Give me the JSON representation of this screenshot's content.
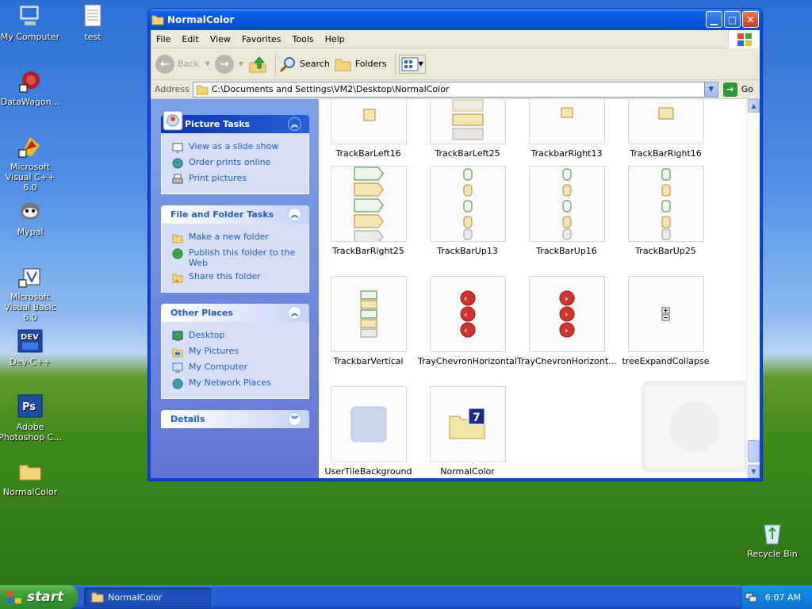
{
  "desktop": {
    "icons": [
      {
        "label": "My Computer"
      },
      {
        "label": "test"
      },
      {
        "label": "DataWagon..."
      },
      {
        "label": "Microsoft Visual C++ 6.0"
      },
      {
        "label": "Mypal"
      },
      {
        "label": "Microsoft Visual Basic 6.0"
      },
      {
        "label": "Dev-C++"
      },
      {
        "label": "Adobe Photoshop C..."
      },
      {
        "label": "NormalColor"
      },
      {
        "label": "Recycle Bin"
      }
    ]
  },
  "window": {
    "title": "NormalColor",
    "menu": [
      "File",
      "Edit",
      "View",
      "Favorites",
      "Tools",
      "Help"
    ],
    "toolbar": {
      "back": "Back",
      "search": "Search",
      "folders": "Folders"
    },
    "address": {
      "label": "Address",
      "value": "C:\\Documents and Settings\\VM2\\Desktop\\NormalColor",
      "go": "Go"
    },
    "taskpane": {
      "picture_tasks": {
        "title": "Picture Tasks",
        "items": [
          "View as a slide show",
          "Order prints online",
          "Print pictures"
        ]
      },
      "file_tasks": {
        "title": "File and Folder Tasks",
        "items": [
          "Make a new folder",
          "Publish this folder to the Web",
          "Share this folder"
        ]
      },
      "other_places": {
        "title": "Other Places",
        "items": [
          "Desktop",
          "My Pictures",
          "My Computer",
          "My Network Places"
        ]
      },
      "details": {
        "title": "Details"
      }
    },
    "files": [
      {
        "name": "TrackBarLeft16"
      },
      {
        "name": "TrackBarLeft25"
      },
      {
        "name": "TrackbarRight13"
      },
      {
        "name": "TrackBarRight16"
      },
      {
        "name": "TrackBarRight25"
      },
      {
        "name": "TrackBarUp13"
      },
      {
        "name": "TrackBarUp16"
      },
      {
        "name": "TrackBarUp25"
      },
      {
        "name": "TrackbarVertical"
      },
      {
        "name": "TrayChevronHorizontal"
      },
      {
        "name": "TrayChevronHorizont..."
      },
      {
        "name": "treeExpandCollapse"
      },
      {
        "name": "UserTileBackground"
      },
      {
        "name": "NormalColor"
      }
    ]
  },
  "taskbar": {
    "start": "start",
    "task_item": "NormalColor",
    "clock": "6:07 AM"
  }
}
